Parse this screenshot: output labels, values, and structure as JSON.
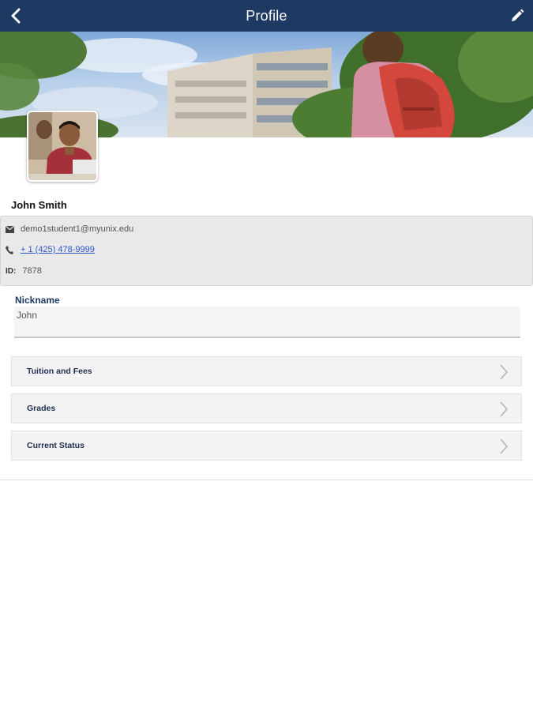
{
  "header": {
    "title": "Profile",
    "back_icon": "chevron-left-icon",
    "edit_icon": "pencil-icon"
  },
  "profile": {
    "name": "John Smith",
    "email": "demo1student1@myunix.edu",
    "phone": "+ 1 (425) 478-9999",
    "id_label": "ID:",
    "id_value": "7878"
  },
  "nickname": {
    "label": "Nickname",
    "value": "John"
  },
  "nav": {
    "items": [
      {
        "label": "Tuition and Fees"
      },
      {
        "label": "Grades"
      },
      {
        "label": "Current Status"
      }
    ]
  },
  "colors": {
    "header_bg": "#1f3a62",
    "link": "#2f55c9",
    "contact_bg": "#e9e9e9",
    "row_bg": "#f3f3f3"
  }
}
